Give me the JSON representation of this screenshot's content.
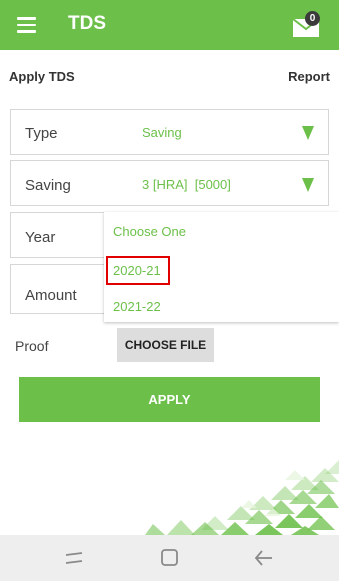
{
  "app": {
    "title": "TDS",
    "menu_icon": "hamburger-menu-icon",
    "mail_icon": "envelope-icon",
    "notification_count": "0",
    "accent_color": "#6cc04a"
  },
  "subheader": {
    "left": "Apply TDS",
    "right": "Report"
  },
  "form": {
    "type": {
      "label": "Type",
      "value": "Saving"
    },
    "saving": {
      "label": "Saving",
      "value": "3 [HRA]  [5000]"
    },
    "year": {
      "label": "Year"
    },
    "amount": {
      "label": "Amount"
    },
    "proof": {
      "label": "Proof",
      "button": "CHOOSE FILE"
    },
    "apply_button": "APPLY"
  },
  "year_dropdown": {
    "options": [
      "Choose One",
      "2020-21",
      "2021-22"
    ],
    "highlighted": "2020-21"
  },
  "system_nav": {
    "icons": [
      "recent-apps-icon",
      "home-icon",
      "back-icon"
    ]
  }
}
